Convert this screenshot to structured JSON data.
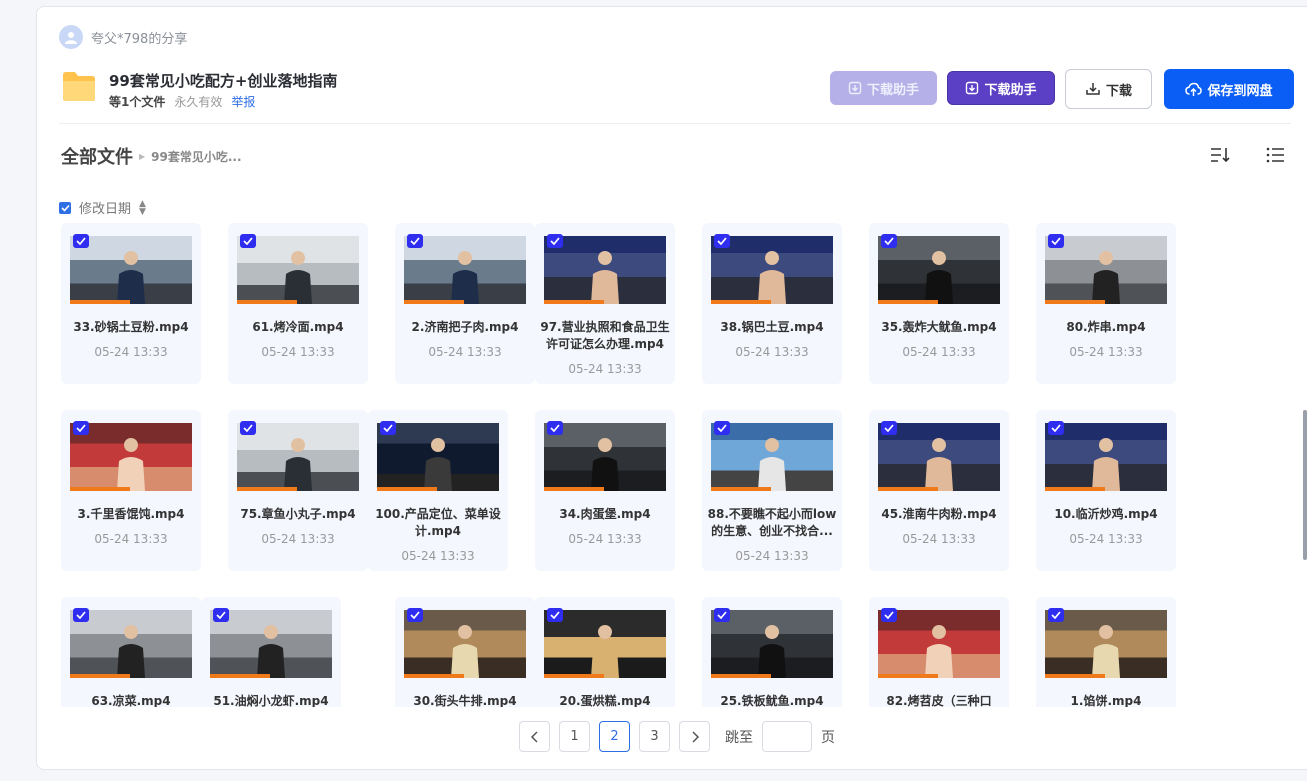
{
  "header": {
    "sharer": "夸父*798的分享",
    "folder_title": "99套常见小吃配方+创业落地指南",
    "file_count": "等1个文件",
    "validity": "永久有效",
    "report": "举报"
  },
  "actions": {
    "ghost_label": "下载助手",
    "helper_label": "下载助手",
    "download_label": "下载",
    "save_label": "保存到网盘"
  },
  "breadcrumb": {
    "root": "全部文件",
    "current": "99套常见小吃..."
  },
  "column": {
    "label": "修改日期"
  },
  "files": [
    {
      "name": "33.砂锅土豆粉.mp4",
      "date": "05-24 13:33",
      "scene": "blue"
    },
    {
      "name": "61.烤冷面.mp4",
      "date": "05-24 13:33",
      "scene": "grey"
    },
    {
      "name": "2.济南把子肉.mp4",
      "date": "05-24 13:33",
      "scene": "blue"
    },
    {
      "name": "97.营业执照和食品卫生许可证怎么办理.mp4",
      "date": "05-24 13:33",
      "scene": "crowd"
    },
    {
      "name": "38.锅巴土豆.mp4",
      "date": "05-24 13:33",
      "scene": "crowd"
    },
    {
      "name": "35.轰炸大鱿鱼.mp4",
      "date": "05-24 13:33",
      "scene": "dark"
    },
    {
      "name": "80.炸串.mp4",
      "date": "05-24 13:33",
      "scene": "kitchen"
    },
    {
      "name": "3.千里香馄饨.mp4",
      "date": "05-24 13:33",
      "scene": "red"
    },
    {
      "name": "75.章鱼小丸子.mp4",
      "date": "05-24 13:33",
      "scene": "grey"
    },
    {
      "name": "100.产品定位、菜单设计.mp4",
      "date": "05-24 13:33",
      "scene": "screen"
    },
    {
      "name": "34.肉蛋堡.mp4",
      "date": "05-24 13:33",
      "scene": "dark"
    },
    {
      "name": "88.不要瞧不起小而low的生意、创业不找合...",
      "date": "05-24 13:33",
      "scene": "tv"
    },
    {
      "name": "45.淮南牛肉粉.mp4",
      "date": "05-24 13:33",
      "scene": "crowd"
    },
    {
      "name": "10.临沂炒鸡.mp4",
      "date": "05-24 13:33",
      "scene": "crowd"
    },
    {
      "name": "63.凉菜.mp4",
      "date": "",
      "scene": "kitchen"
    },
    {
      "name": "51.油焖小龙虾.mp4",
      "date": "",
      "scene": "kitchen"
    },
    {
      "name": "30.街头牛排.mp4",
      "date": "",
      "scene": "food"
    },
    {
      "name": "20.蛋烘糕.mp4",
      "date": "",
      "scene": "pan"
    },
    {
      "name": "25.铁板鱿鱼.mp4",
      "date": "",
      "scene": "dark"
    },
    {
      "name": "82.烤苕皮（三种口",
      "date": "",
      "scene": "red"
    },
    {
      "name": "1.馅饼.mp4",
      "date": "",
      "scene": "food"
    }
  ],
  "pagination": {
    "pages": [
      "1",
      "2",
      "3"
    ],
    "current": "2",
    "jump_label": "跳至",
    "page_suffix": "页"
  }
}
